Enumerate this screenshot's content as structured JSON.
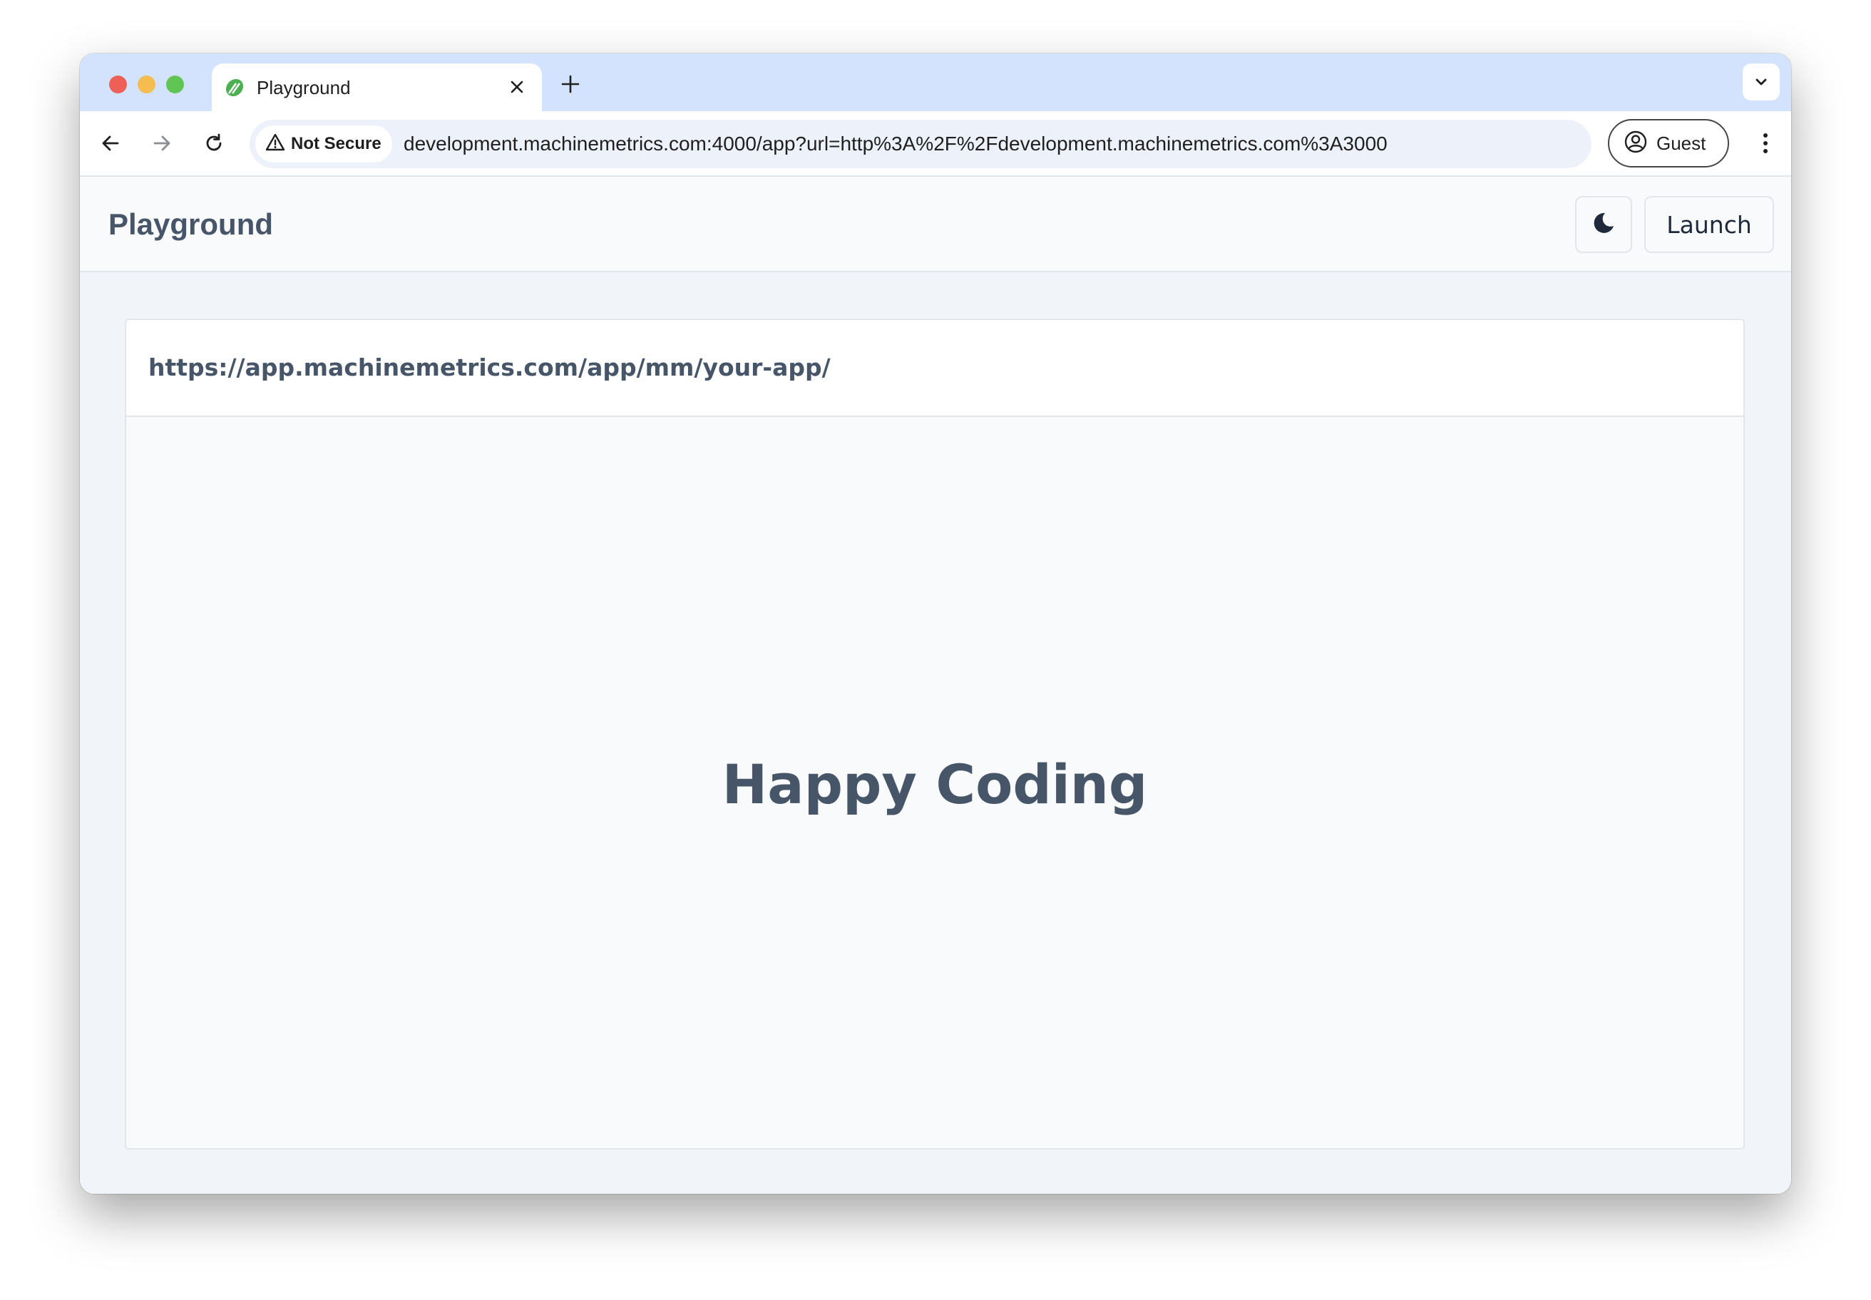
{
  "browser": {
    "tab": {
      "title": "Playground"
    },
    "address": {
      "security_label": "Not Secure",
      "url": "development.machinemetrics.com:4000/app?url=http%3A%2F%2Fdevelopment.machinemetrics.com%3A3000"
    },
    "profile_label": "Guest"
  },
  "app": {
    "title": "Playground",
    "launch_label": "Launch"
  },
  "frame": {
    "url": "https://app.machinemetrics.com/app/mm/your-app/",
    "message": "Happy Coding"
  },
  "colors": {
    "tabstrip": "#d3e3fd",
    "omnibox": "#edf2fa",
    "text_muted": "#475569",
    "favicon": "#4caf50"
  },
  "icons": {
    "favicon": "leaf-icon",
    "close": "close-icon",
    "new_tab": "plus-icon",
    "tab_search": "chevron-down-icon",
    "back": "arrow-left-icon",
    "forward": "arrow-right-icon",
    "reload": "reload-icon",
    "security": "warning-icon",
    "profile": "user-circle-icon",
    "menu": "kebab-menu-icon",
    "theme": "moon-icon"
  }
}
